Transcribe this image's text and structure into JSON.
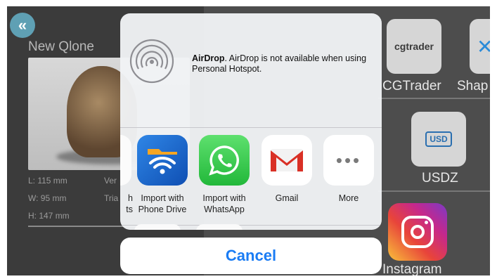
{
  "app": {
    "model_title": "New Qlone",
    "stats": {
      "length": "L: 115 mm",
      "width": "W: 95 mm",
      "height": "H: 147 mm",
      "vertices_partial": "Ver",
      "triangles_partial": "Tria"
    },
    "export_tiles": [
      {
        "label": "CGTrader",
        "tile_text": "cgtrader"
      },
      {
        "label": "Shap"
      },
      {
        "label": "USDZ",
        "tile_text": "USD"
      },
      {
        "label": "Instagram"
      }
    ]
  },
  "share_sheet": {
    "airdrop_title": "AirDrop",
    "airdrop_message": ". AirDrop is not available when using Personal Hotspot.",
    "apps": [
      {
        "label_line1": "h",
        "label_line2": "ts"
      },
      {
        "label_line1": "Import with",
        "label_line2": "Phone Drive",
        "icon": "phone-drive-wifi-icon"
      },
      {
        "label_line1": "Import with",
        "label_line2": "WhatsApp",
        "icon": "whatsapp-icon"
      },
      {
        "label_line1": "Gmail",
        "label_line2": "",
        "icon": "gmail-icon"
      },
      {
        "label_line1": "More",
        "label_line2": "",
        "icon": "more-dots-icon"
      }
    ],
    "cancel_label": "Cancel"
  },
  "colors": {
    "accent": "#1a7cf4",
    "whatsapp": "#2fc24e",
    "gmail_red": "#d93025",
    "phone_drive_blue": "#1a66c9"
  }
}
